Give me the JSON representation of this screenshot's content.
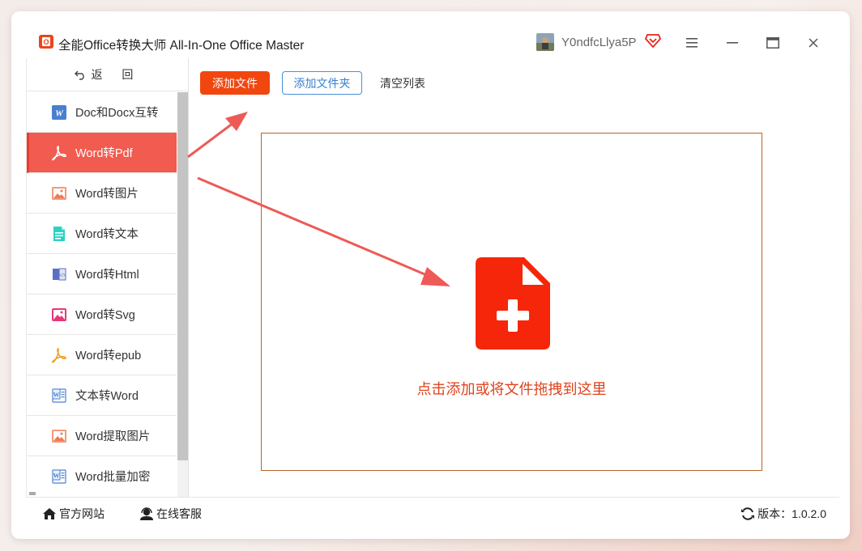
{
  "app": {
    "title": "全能Office转换大师 All-In-One Office Master",
    "username": "Y0ndfcLlya5P"
  },
  "window_controls": [
    "menu-icon",
    "minimize-icon",
    "maximize-icon",
    "close-icon"
  ],
  "sidebar": {
    "back_label": "返 回",
    "items": [
      {
        "label": "Doc和Docx互转",
        "icon": "word-doc-icon"
      },
      {
        "label": "Word转Pdf",
        "icon": "pdf-icon",
        "active": true
      },
      {
        "label": "Word转图片",
        "icon": "image-icon"
      },
      {
        "label": "Word转文本",
        "icon": "text-doc-icon"
      },
      {
        "label": "Word转Html",
        "icon": "html-book-icon"
      },
      {
        "label": "Word转Svg",
        "icon": "svg-image-icon"
      },
      {
        "label": "Word转epub",
        "icon": "epub-icon"
      },
      {
        "label": "文本转Word",
        "icon": "word-outline-icon"
      },
      {
        "label": "Word提取图片",
        "icon": "image-icon"
      },
      {
        "label": "Word批量加密",
        "icon": "word-outline-icon"
      }
    ]
  },
  "toolbar": {
    "add_file": "添加文件",
    "add_folder": "添加文件夹",
    "clear_list": "清空列表"
  },
  "dropzone": {
    "text": "点击添加或将文件拖拽到这里"
  },
  "statusbar": {
    "website": "官方网站",
    "support": "在线客服",
    "version_label": "版本：",
    "version": "1.0.2.0"
  },
  "colors": {
    "accent": "#f2460f",
    "active_item": "#f25b4f",
    "drop_icon": "#f5260a",
    "arrow": "#ee5a56",
    "folder_button": "#4a90d9"
  }
}
